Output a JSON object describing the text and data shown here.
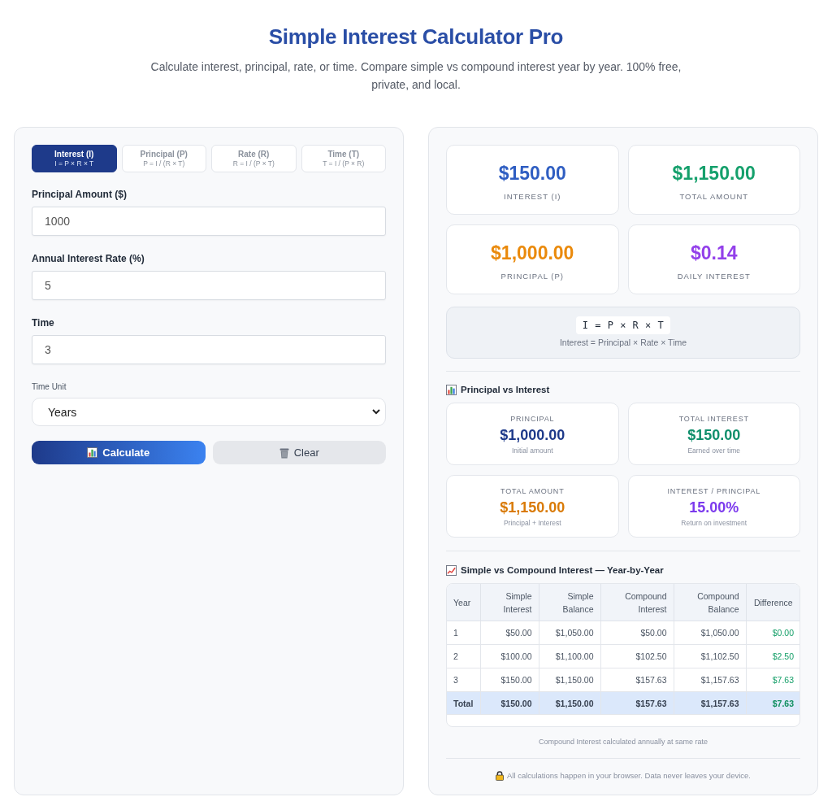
{
  "header": {
    "title": "Simple Interest Calculator Pro",
    "subtitle": "Calculate interest, principal, rate, or time. Compare simple vs compound interest year by year. 100% free, private, and local."
  },
  "calculator": {
    "modes": [
      {
        "label": "Interest (I)",
        "formula": "I = P × R × T",
        "selected": true
      },
      {
        "label": "Principal (P)",
        "formula": "P = I / (R × T)",
        "selected": false
      },
      {
        "label": "Rate (R)",
        "formula": "R = I / (P × T)",
        "selected": false
      },
      {
        "label": "Time (T)",
        "formula": "T = I / (P × R)",
        "selected": false
      }
    ],
    "fields": [
      {
        "kind": "input",
        "label": "Principal Amount ($)",
        "value": "1000"
      },
      {
        "kind": "input",
        "label": "Annual Interest Rate (%)",
        "value": "5"
      },
      {
        "kind": "input",
        "label": "Time",
        "value": "3"
      },
      {
        "kind": "select",
        "label": "Time Unit",
        "value": "Years"
      }
    ],
    "buttons": [
      {
        "kind": "primary",
        "label": "Calculate"
      },
      {
        "kind": "secondary",
        "label": "Clear"
      }
    ]
  },
  "results": {
    "summary_cards": [
      {
        "value": "$150.00",
        "label": "INTEREST (I)",
        "color": "#2f5ec2"
      },
      {
        "value": "$1,150.00",
        "label": "TOTAL AMOUNT",
        "color": "#15a06c"
      },
      {
        "value": "$1,000.00",
        "label": "PRINCIPAL (P)",
        "color": "#ea8a0c"
      },
      {
        "value": "$0.14",
        "label": "DAILY INTEREST",
        "color": "#9340ea"
      }
    ],
    "formula": {
      "expression": "I = P × R × T",
      "description": "Interest = Principal × Rate × Time"
    },
    "breakdown": {
      "title": "Principal vs Interest",
      "cards": [
        {
          "label": "PRINCIPAL",
          "value": "$1,000.00",
          "note": "Initial amount",
          "color": "#1e3a8a"
        },
        {
          "label": "TOTAL INTEREST",
          "value": "$150.00",
          "note": "Earned over time",
          "color": "#0f8f6c"
        },
        {
          "label": "TOTAL AMOUNT",
          "value": "$1,150.00",
          "note": "Principal + Interest",
          "color": "#d97a06"
        },
        {
          "label": "INTEREST / PRINCIPAL",
          "value": "15.00%",
          "note": "Return on investment",
          "color": "#7c3aed"
        }
      ]
    },
    "comparison": {
      "title": "Simple vs Compound Interest — Year-by-Year",
      "columns": [
        "Year",
        "Simple Interest",
        "Simple Balance",
        "Compound Interest",
        "Compound Balance",
        "Difference"
      ],
      "rows": [
        {
          "kind": "year",
          "cells": [
            "1",
            "$50.00",
            "$1,050.00",
            "$50.00",
            "$1,050.00",
            "$0.00"
          ]
        },
        {
          "kind": "year",
          "cells": [
            "2",
            "$100.00",
            "$1,100.00",
            "$102.50",
            "$1,102.50",
            "$2.50"
          ]
        },
        {
          "kind": "year",
          "cells": [
            "3",
            "$150.00",
            "$1,150.00",
            "$157.63",
            "$1,157.63",
            "$7.63"
          ]
        },
        {
          "kind": "total",
          "cells": [
            "Total",
            "$150.00",
            "$1,150.00",
            "$157.63",
            "$1,157.63",
            "$7.63"
          ]
        }
      ],
      "footnote": "Compound Interest calculated annually at same rate"
    },
    "privacy_note": "All calculations happen in your browser. Data never leaves your device."
  }
}
